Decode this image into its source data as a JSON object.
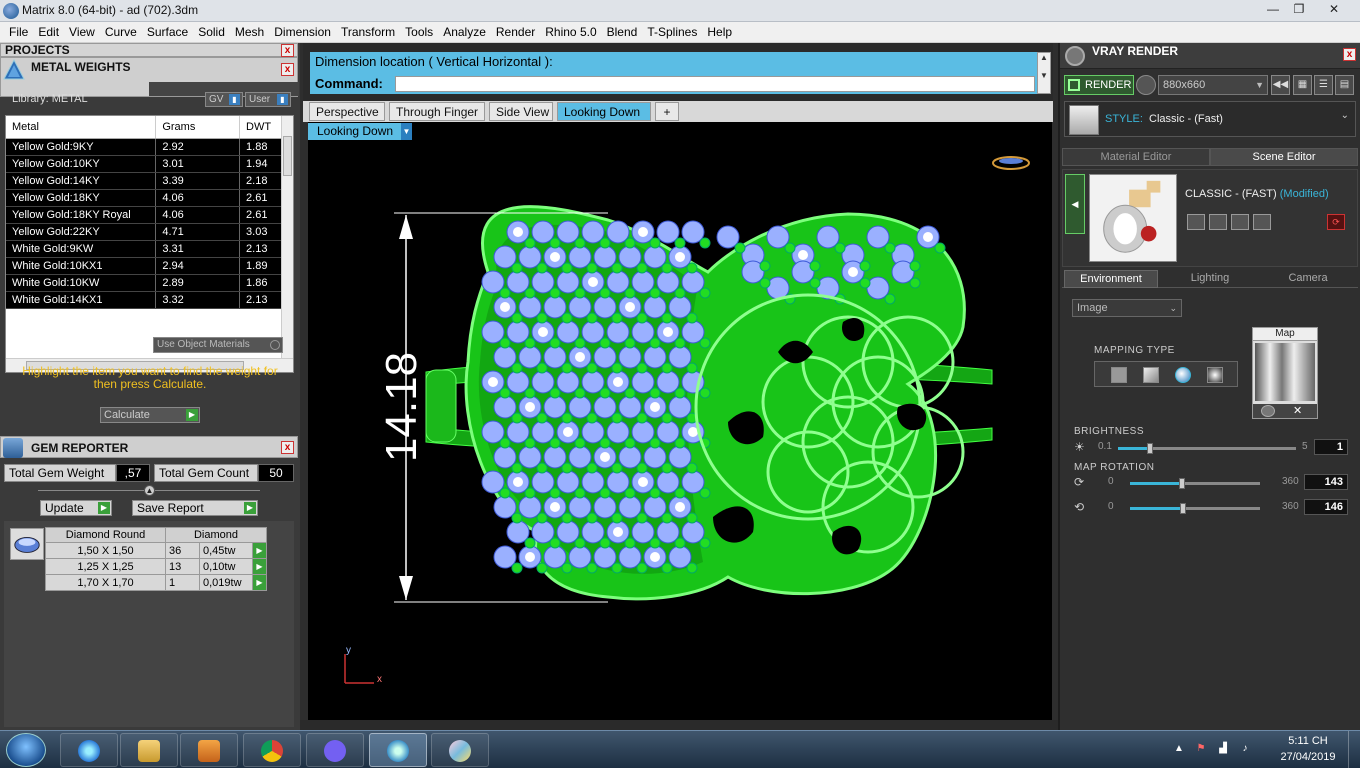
{
  "window": {
    "title": "Matrix 8.0 (64-bit) - ad (702).3dm",
    "minimize": "—",
    "maximize": "❐",
    "close": "✕"
  },
  "menu": [
    "File",
    "Edit",
    "View",
    "Curve",
    "Surface",
    "Solid",
    "Mesh",
    "Dimension",
    "Transform",
    "Tools",
    "Analyze",
    "Render",
    "Rhino 5.0",
    "Blend",
    "T-Splines",
    "Help"
  ],
  "left": {
    "projects_title": "PROJECTS",
    "metal_weights": {
      "title": "METAL WEIGHTS",
      "library_label": "Library: METAL",
      "gv_label": "GV",
      "user_label": "User",
      "columns": [
        "Metal",
        "Grams",
        "DWT"
      ],
      "rows": [
        [
          "Yellow Gold:9KY",
          "2.92",
          "1.88"
        ],
        [
          "Yellow Gold:10KY",
          "3.01",
          "1.94"
        ],
        [
          "Yellow Gold:14KY",
          "3.39",
          "2.18"
        ],
        [
          "Yellow Gold:18KY",
          "4.06",
          "2.61"
        ],
        [
          "Yellow Gold:18KY Royal",
          "4.06",
          "2.61"
        ],
        [
          "Yellow Gold:22KY",
          "4.71",
          "3.03"
        ],
        [
          "White Gold:9KW",
          "3.31",
          "2.13"
        ],
        [
          "White Gold:10KX1",
          "2.94",
          "1.89"
        ],
        [
          "White Gold:10KW",
          "2.89",
          "1.86"
        ],
        [
          "White Gold:14KX1",
          "3.32",
          "2.13"
        ]
      ],
      "use_object_materials": "Use Object Materials",
      "highlight_message": "Highlight the item you want to find the weight for then press Calculate.",
      "calculate_label": "Calculate"
    },
    "gem_reporter": {
      "title": "GEM REPORTER",
      "total_weight_label": "Total Gem Weight",
      "total_weight_value": ",57",
      "total_count_label": "Total Gem Count",
      "total_count_value": "50",
      "update_label": "Update",
      "save_report_label": "Save Report",
      "table_headers": [
        "Diamond Round",
        "Diamond"
      ],
      "rows": [
        [
          "1,50 X 1,50",
          "36",
          "0,45tw"
        ],
        [
          "1,25 X 1,25",
          "13",
          "0,10tw"
        ],
        [
          "1,70 X 1,70",
          "1",
          "0,019tw"
        ]
      ]
    }
  },
  "center": {
    "command_line1": "Dimension location ( Vertical  Horizontal ):",
    "command_label": "Command:",
    "tabs": [
      "Perspective",
      "Through Finger",
      "Side View",
      "Looking Down",
      "+"
    ],
    "active_view": "Looking Down",
    "dimension_value": "14.18",
    "axis_y": "y",
    "axis_x": "x"
  },
  "right": {
    "title": "VRAY RENDER",
    "render_label": "RENDER",
    "resolution": "880x660",
    "style_label": "STYLE:",
    "style_value": "Classic - (Fast)",
    "editor_tabs": [
      "Material Editor",
      "Scene Editor"
    ],
    "scene_name": "CLASSIC - (FAST)",
    "scene_modified": "(Modified)",
    "env_tabs": [
      "Environment",
      "Lighting",
      "Camera"
    ],
    "environment_type": "Image",
    "mapping_type_label": "MAPPING TYPE",
    "map_label": "Map",
    "brightness_label": "BRIGHTNESS",
    "brightness": {
      "min": "0.1",
      "max": "5",
      "value": "1",
      "fraction": 0.18
    },
    "map_rotation_label": "MAP ROTATION",
    "rotation_h": {
      "min": "0",
      "max": "360",
      "value": "143",
      "fraction": 0.4
    },
    "rotation_v": {
      "min": "0",
      "max": "360",
      "value": "146",
      "fraction": 0.41
    }
  },
  "taskbar": {
    "time": "5:11 CH",
    "date": "27/04/2019"
  },
  "colors": {
    "accent_blue": "#5bbde4",
    "ring_green": "#22dd22",
    "stone_blue": "#9ab0ff",
    "warning_yellow": "#f0c020"
  }
}
